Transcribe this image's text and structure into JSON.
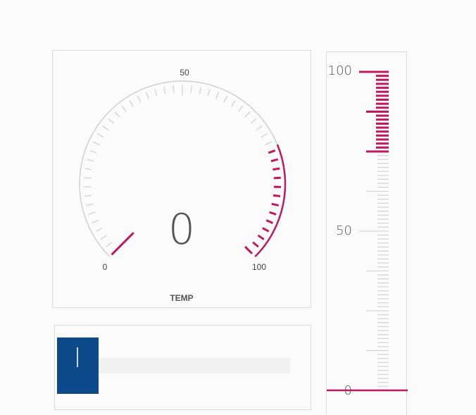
{
  "gauge": {
    "value": "0",
    "label": "TEMP",
    "min_label": "0",
    "mid_label": "50",
    "max_label": "100",
    "min": 0,
    "max": 100,
    "highlight_from": 75,
    "highlight_to": 100,
    "accent_color": "#c2185b",
    "tick_color": "#d6d6d6"
  },
  "slider": {
    "value_fraction": 0,
    "thumb_color": "#0c4a8c",
    "track_color": "#f1f1f1"
  },
  "linear_scale": {
    "top_label": "100",
    "mid_label": "50",
    "bottom_label": "0",
    "min": 0,
    "max": 100,
    "highlight_from": 75,
    "highlight_to": 100,
    "value": 0,
    "accent_color": "#c2185b",
    "tick_color": "#d6d6d6"
  }
}
